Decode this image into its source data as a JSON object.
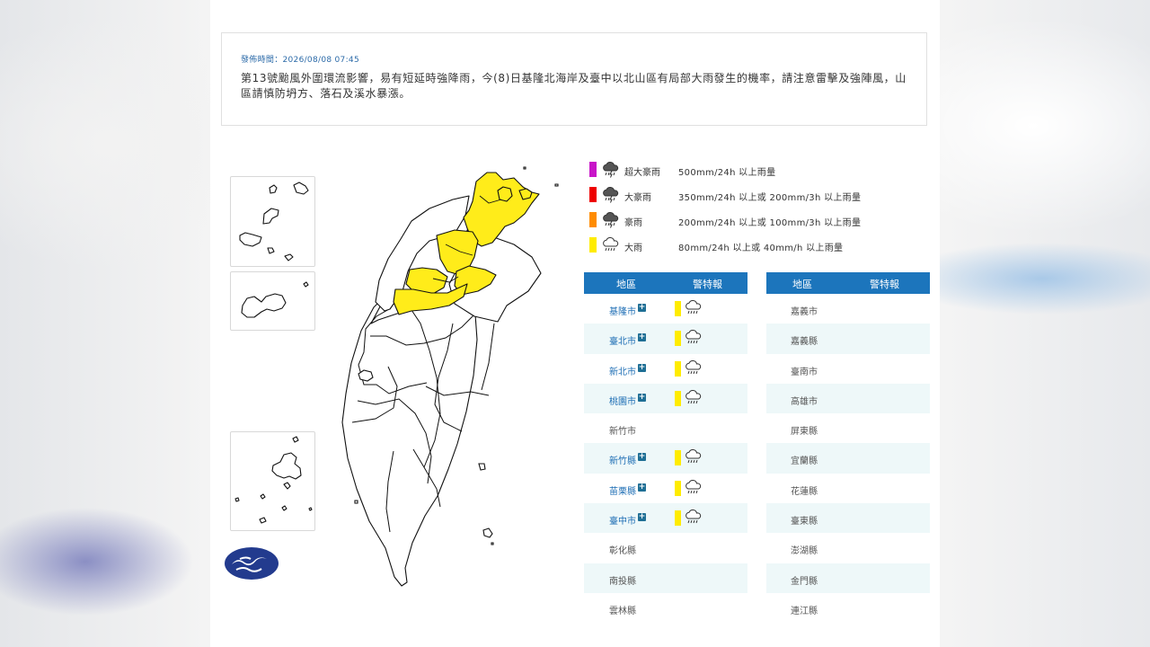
{
  "notice": {
    "time": "發佈時間：2026/08/08 07:45",
    "text": "第13號颱風外圍環流影響，易有短延時強降雨，今(8)日基隆北海岸及臺中以北山區有局部大雨發生的機率，請注意雷擊及強陣風，山區請慎防坍方、落石及溪水暴漲。"
  },
  "legend": [
    {
      "name": "超大豪雨",
      "desc": "500mm/24h 以上雨量",
      "color": "#c815c8",
      "icon": "heavy-rain-lightning-icon"
    },
    {
      "name": "大豪雨",
      "desc": "350mm/24h 以上或 200mm/3h 以上雨量",
      "color": "#ee0000",
      "icon": "heavy-rain-lightning-icon"
    },
    {
      "name": "豪雨",
      "desc": "200mm/24h 以上或 100mm/3h 以上雨量",
      "color": "#ff8c00",
      "icon": "heavy-rain-lightning-icon"
    },
    {
      "name": "大雨",
      "desc": "80mm/24h 以上或 40mm/h 以上雨量",
      "color": "#ffec00",
      "icon": "rain-cloud-icon"
    }
  ],
  "table_left": {
    "headers": [
      "地區",
      "警特報"
    ],
    "rows": [
      {
        "region": "基隆市",
        "warning": "大雨"
      },
      {
        "region": "臺北市",
        "warning": "大雨"
      },
      {
        "region": "新北市",
        "warning": "大雨"
      },
      {
        "region": "桃園市",
        "warning": "大雨"
      },
      {
        "region": "新竹市",
        "warning": ""
      },
      {
        "region": "新竹縣",
        "warning": "大雨"
      },
      {
        "region": "苗栗縣",
        "warning": "大雨"
      },
      {
        "region": "臺中市",
        "warning": "大雨"
      },
      {
        "region": "彰化縣",
        "warning": ""
      },
      {
        "region": "南投縣",
        "warning": ""
      },
      {
        "region": "雲林縣",
        "warning": ""
      }
    ]
  },
  "table_right": {
    "headers": [
      "地區",
      "警特報"
    ],
    "rows": [
      {
        "region": "嘉義市",
        "warning": ""
      },
      {
        "region": "嘉義縣",
        "warning": ""
      },
      {
        "region": "臺南市",
        "warning": ""
      },
      {
        "region": "高雄市",
        "warning": ""
      },
      {
        "region": "屏東縣",
        "warning": ""
      },
      {
        "region": "宜蘭縣",
        "warning": ""
      },
      {
        "region": "花蓮縣",
        "warning": ""
      },
      {
        "region": "臺東縣",
        "warning": ""
      },
      {
        "region": "澎湖縣",
        "warning": ""
      },
      {
        "region": "金門縣",
        "warning": ""
      },
      {
        "region": "連江縣",
        "warning": ""
      }
    ]
  },
  "colors": {
    "header": "#1c75bc",
    "warning_heavy_rain": "#ffec00",
    "row_alt": "#eef8f9"
  }
}
